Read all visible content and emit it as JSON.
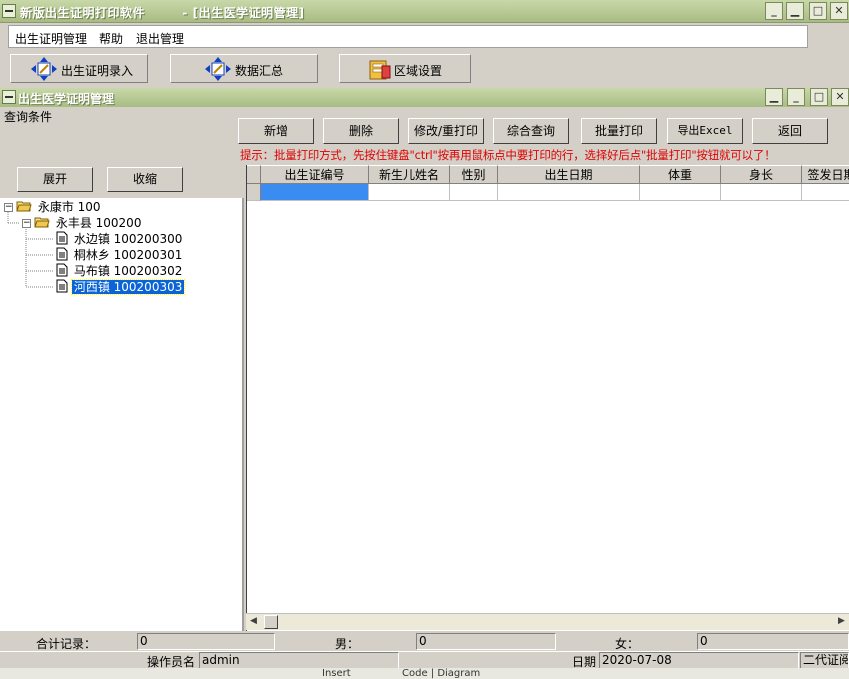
{
  "window": {
    "title": "新版出生证明打印软件        - [出生医学证明管理]",
    "buttons": {
      "minimize": "_",
      "restore": "▫",
      "close": "✕"
    }
  },
  "menu": {
    "items": [
      "出生证明管理",
      "帮助",
      "退出管理"
    ]
  },
  "toolbar": {
    "buttons": [
      {
        "label": "出生证明录入",
        "icon": "arrows-edit-icon"
      },
      {
        "label": "数据汇总",
        "icon": "arrows-edit-icon"
      },
      {
        "label": "区域设置",
        "icon": "settings-folder-icon"
      }
    ]
  },
  "subwindow": {
    "title": "出生医学证明管理"
  },
  "query": {
    "label": "查询条件",
    "buttons": [
      "新增",
      "删除",
      "修改/重打印",
      "综合查询",
      "批量打印",
      "导出Excel",
      "返回"
    ],
    "hint": "提示：批量打印方式，先按住键盘\"ctrl\"按再用鼠标点中要打印的行，选择好后点\"批量打印\"按钮就可以了！"
  },
  "tree_panel": {
    "expand_label": "展开",
    "collapse_label": "收缩",
    "nodes": [
      {
        "label": "永康市  100",
        "level": 0,
        "kind": "folder",
        "selected": false
      },
      {
        "label": "永丰县  100200",
        "level": 1,
        "kind": "folder",
        "selected": false
      },
      {
        "label": "水边镇  100200300",
        "level": 2,
        "kind": "doc",
        "selected": false
      },
      {
        "label": "桐林乡  100200301",
        "level": 2,
        "kind": "doc",
        "selected": false
      },
      {
        "label": "马布镇  100200302",
        "level": 2,
        "kind": "doc",
        "selected": false
      },
      {
        "label": "河西镇  100200303",
        "level": 2,
        "kind": "doc",
        "selected": true
      }
    ]
  },
  "grid": {
    "columns": [
      "出生证编号",
      "新生儿姓名",
      "性别",
      "出生日期",
      "体重",
      "身长",
      "签发日期"
    ],
    "rows": [
      [
        "",
        "",
        "",
        "",
        "",
        "",
        ""
      ]
    ]
  },
  "status": {
    "total_label": "合计记录：",
    "total_value": "0",
    "male_label": "男：",
    "male_value": "0",
    "female_label": "女：",
    "female_value": "0",
    "operator_label": "操作员名",
    "operator_value": "admin",
    "date_label": "日期",
    "date_value": "2020-07-08",
    "extra_value": "二代证阅"
  },
  "taskbar": {
    "items": [
      "Insert",
      "Code | Diagram"
    ]
  },
  "colors": {
    "title_gradient_top": "#c8d8a8",
    "title_gradient_bottom": "#a8bc84",
    "face": "#d4d0c8",
    "hint_red": "#e00000",
    "selection_blue": "#0a64d8"
  }
}
